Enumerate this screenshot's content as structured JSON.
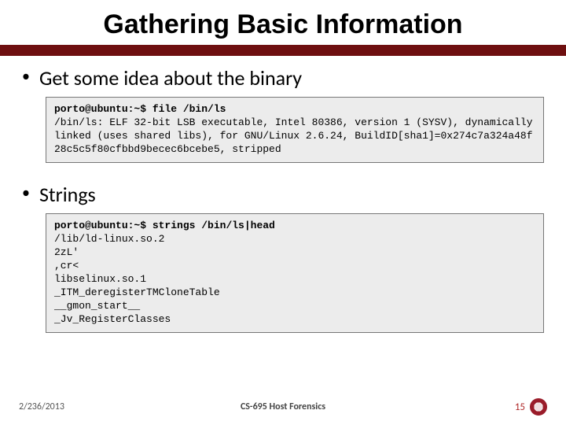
{
  "title": "Gathering Basic Information",
  "bullets": {
    "b1": "Get some idea about the binary",
    "b2": "Strings"
  },
  "code1": {
    "prompt": "porto@ubuntu:~$ ",
    "cmd": "file /bin/ls",
    "output": "/bin/ls: ELF 32-bit LSB executable, Intel 80386, version 1 (SYSV), dynamically linked (uses shared libs), for GNU/Linux 2.6.24, BuildID[sha1]=0x274c7a324a48f28c5c5f80cfbbd9becec6bcebe5, stripped"
  },
  "code2": {
    "prompt": "porto@ubuntu:~$ ",
    "cmd": "strings /bin/ls|head",
    "output": "/lib/ld-linux.so.2\n2zL'\n,cr<\nlibselinux.so.1\n_ITM_deregisterTMCloneTable\n__gmon_start__\n_Jv_RegisterClasses"
  },
  "footer": {
    "left": "2/236/2013",
    "center": "CS-695 Host Forensics",
    "page": "15"
  }
}
